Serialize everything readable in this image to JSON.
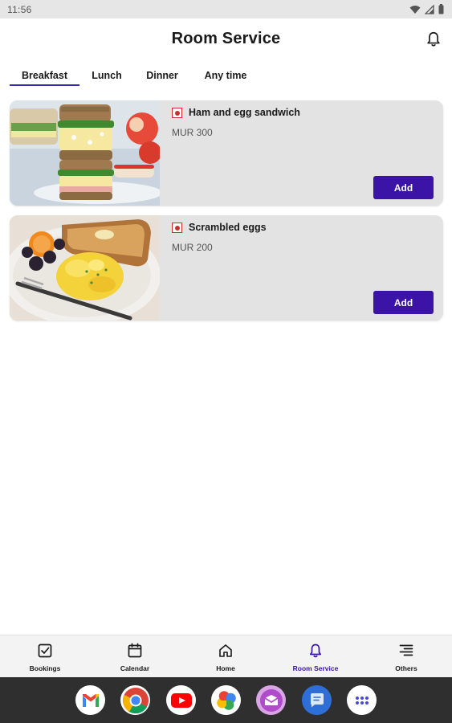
{
  "status_bar": {
    "time": "11:56"
  },
  "header": {
    "title": "Room Service"
  },
  "tabs": [
    {
      "label": "Breakfast",
      "active": true
    },
    {
      "label": "Lunch",
      "active": false
    },
    {
      "label": "Dinner",
      "active": false
    },
    {
      "label": "Any time",
      "active": false
    }
  ],
  "items": [
    {
      "name": "Ham and egg sandwich",
      "price": "MUR 300",
      "add_label": "Add"
    },
    {
      "name": "Scrambled eggs",
      "price": "MUR 200",
      "add_label": "Add"
    }
  ],
  "bottom_nav": [
    {
      "label": "Bookings",
      "icon": "check-square-icon",
      "active": false
    },
    {
      "label": "Calendar",
      "icon": "calendar-icon",
      "active": false
    },
    {
      "label": "Home",
      "icon": "home-icon",
      "active": false
    },
    {
      "label": "Room Service",
      "icon": "bell-icon",
      "active": true
    },
    {
      "label": "Others",
      "icon": "menu-lines-icon",
      "active": false
    }
  ],
  "dock_apps": [
    "gmail-icon",
    "chrome-icon",
    "youtube-icon",
    "photos-icon",
    "mail-app-icon",
    "messages-icon",
    "app-drawer-icon"
  ],
  "colors": {
    "accent": "#3b14a7",
    "card_bg": "#e3e3e3",
    "veg_mark": "#c9302c",
    "dock_bg": "#2f2f2f"
  }
}
